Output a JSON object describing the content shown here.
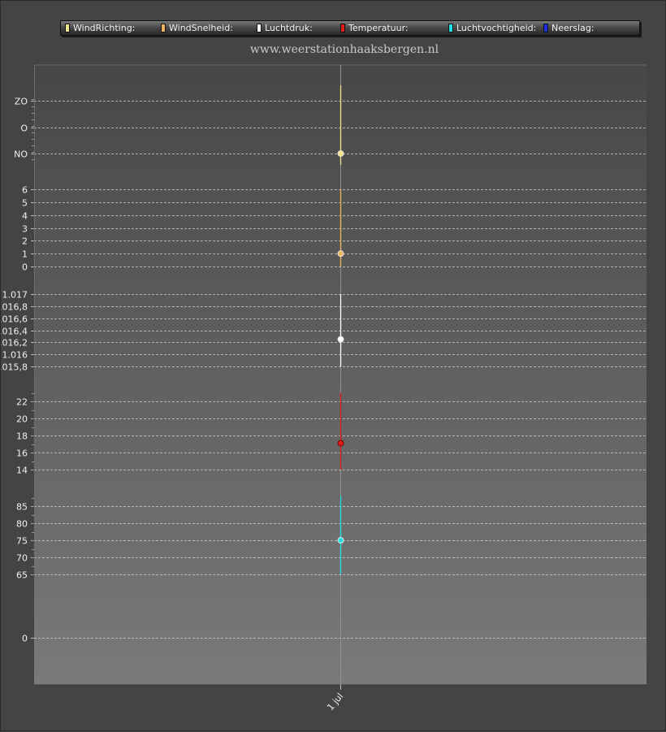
{
  "legend": {
    "items": [
      {
        "label": "WindRichting:",
        "color": "#f3e58a"
      },
      {
        "label": "WindSnelheid:",
        "color": "#f0b45a"
      },
      {
        "label": "Luchtdruk:",
        "color": "#ffffff"
      },
      {
        "label": "Temperatuur:",
        "color": "#e01b1b"
      },
      {
        "label": "Luchtvochtigheid:",
        "color": "#22e0e8"
      },
      {
        "label": "Neerslag:",
        "color": "#1a2ee0"
      }
    ]
  },
  "site_title": "www.weerstationhaaksbergen.nl",
  "chart_data": [
    {
      "type": "line",
      "series": [
        {
          "name": "WindRichting",
          "color": "#f3e58a",
          "x": [
            "1 jul"
          ],
          "values": [
            "NO"
          ],
          "min": "N",
          "max": "ZO"
        }
      ],
      "yticks": [
        "NO",
        "O",
        "ZO"
      ],
      "grid": true
    },
    {
      "type": "line",
      "series": [
        {
          "name": "WindSnelheid",
          "color": "#f0b45a",
          "x": [
            "1 jul"
          ],
          "values": [
            1
          ],
          "min": 0,
          "max": 6
        }
      ],
      "yticks": [
        "0",
        "1",
        "2",
        "3",
        "4",
        "5",
        "6"
      ],
      "ylim": [
        0,
        6
      ],
      "grid": true
    },
    {
      "type": "line",
      "series": [
        {
          "name": "Luchtdruk",
          "color": "#ffffff",
          "x": [
            "1 jul"
          ],
          "values": [
            1016.25
          ],
          "min": 1015.8,
          "max": 1017.0
        }
      ],
      "yticks": [
        "1.015,8",
        "1.016",
        "1.016,2",
        "1.016,4",
        "1.016,6",
        "1.016,8",
        "1.017"
      ],
      "ylim": [
        1015.8,
        1017.0
      ],
      "grid": true
    },
    {
      "type": "line",
      "series": [
        {
          "name": "Temperatuur",
          "color": "#e01b1b",
          "x": [
            "1 jul"
          ],
          "values": [
            17.1
          ],
          "min": 14,
          "max": 23
        }
      ],
      "yticks": [
        "14",
        "16",
        "18",
        "20",
        "22"
      ],
      "ylim": [
        14,
        23
      ],
      "grid": true
    },
    {
      "type": "line",
      "series": [
        {
          "name": "Luchtvochtigheid",
          "color": "#22e0e8",
          "x": [
            "1 jul"
          ],
          "values": [
            75
          ],
          "min": 65,
          "max": 88
        }
      ],
      "yticks": [
        "65",
        "70",
        "75",
        "80",
        "85"
      ],
      "ylim": [
        65,
        88
      ],
      "grid": true
    },
    {
      "type": "bar",
      "series": [
        {
          "name": "Neerslag",
          "color": "#1a2ee0",
          "x": [
            "1 jul"
          ],
          "values": [
            0
          ]
        }
      ],
      "yticks": [
        "0"
      ],
      "grid": true
    }
  ],
  "x_axis": {
    "tick_labels": [
      "1 jul"
    ]
  }
}
